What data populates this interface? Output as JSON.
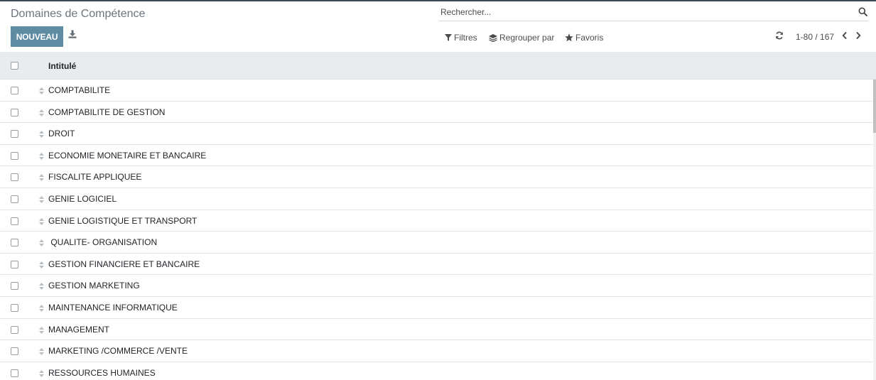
{
  "app": {
    "title": "Domaines de Compétence"
  },
  "toolbar": {
    "new_label": "NOUVEAU",
    "download_icon": "download-icon"
  },
  "search": {
    "placeholder": "Rechercher...",
    "value": "",
    "icon": "search-icon"
  },
  "filters": {
    "filters_label": "Filtres",
    "groupby_label": "Regrouper par",
    "favorites_label": "Favoris"
  },
  "pager": {
    "value": "1-80 / 167"
  },
  "list": {
    "column_header": "Intitulé",
    "rows": [
      {
        "label": "COMPTABILITE"
      },
      {
        "label": "COMPTABILITE DE GESTION"
      },
      {
        "label": "DROIT"
      },
      {
        "label": "ECONOMIE MONETAIRE ET BANCAIRE"
      },
      {
        "label": "FISCALITE APPLIQUEE"
      },
      {
        "label": "GENIE LOGICIEL"
      },
      {
        "label": "GENIE LOGISTIQUE ET TRANSPORT"
      },
      {
        "label": " QUALITE- ORGANISATION"
      },
      {
        "label": "GESTION FINANCIERE ET BANCAIRE"
      },
      {
        "label": "GESTION MARKETING"
      },
      {
        "label": "MAINTENANCE INFORMATIQUE"
      },
      {
        "label": "MANAGEMENT"
      },
      {
        "label": "MARKETING /COMMERCE /VENTE"
      },
      {
        "label": "RESSOURCES HUMAINES"
      }
    ]
  },
  "colors": {
    "primary_button": "#5f8ba3",
    "header_bg": "#e9ecef",
    "muted_text": "#6c757d"
  }
}
